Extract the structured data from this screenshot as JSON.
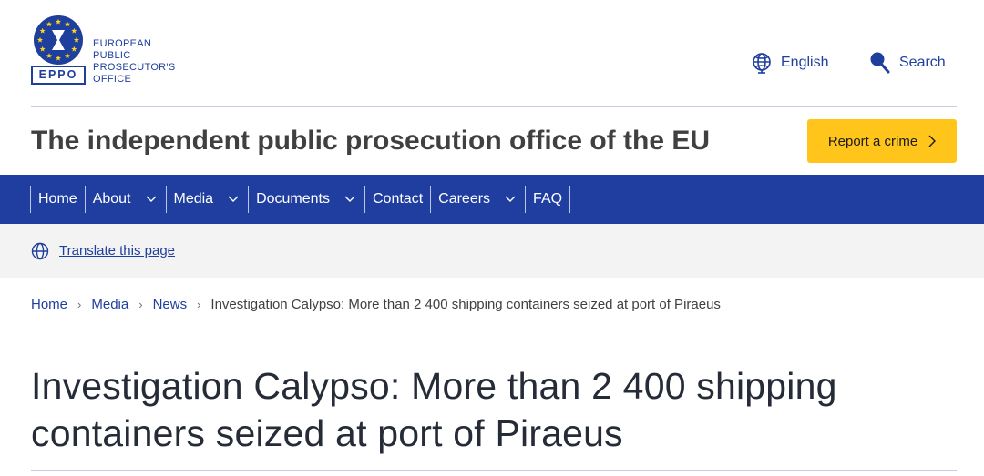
{
  "header": {
    "logo": {
      "acronym": "EPPO",
      "name_lines": [
        "EUROPEAN",
        "PUBLIC",
        "PROSECUTOR'S",
        "OFFICE"
      ]
    },
    "language": {
      "label": "English",
      "icon": "globe-icon"
    },
    "search": {
      "label": "Search",
      "icon": "search-icon"
    },
    "site_title": "The independent public prosecution office of the EU",
    "report_button": {
      "label": "Report a crime",
      "icon": "chevron-right-icon"
    }
  },
  "nav": {
    "items": [
      {
        "label": "Home",
        "has_dropdown": false
      },
      {
        "label": "About",
        "has_dropdown": true
      },
      {
        "label": "Media",
        "has_dropdown": true
      },
      {
        "label": "Documents",
        "has_dropdown": true
      },
      {
        "label": "Contact",
        "has_dropdown": false
      },
      {
        "label": "Careers",
        "has_dropdown": true
      },
      {
        "label": "FAQ",
        "has_dropdown": false
      }
    ]
  },
  "translate": {
    "label": "Translate this page",
    "icon": "globe-icon"
  },
  "breadcrumb": {
    "items": [
      "Home",
      "Media",
      "News"
    ],
    "current": "Investigation Calypso: More than 2 400 shipping containers seized at port of Piraeus"
  },
  "article": {
    "title_lines": [
      "Investigation Calypso: More than 2 400 shipping",
      "containers seized at port of Piraeus"
    ]
  },
  "colors": {
    "brand_blue": "#1f3ea0",
    "link_blue": "#1f3f9d",
    "accent_yellow": "#ffc51a",
    "eu_star_yellow": "#ffd617"
  }
}
